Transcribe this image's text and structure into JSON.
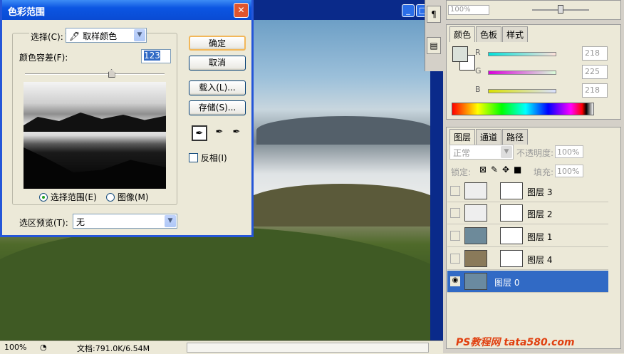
{
  "dialog": {
    "title": "色彩范围",
    "select_label": "选择(C):",
    "select_value": "取样颜色",
    "fuzziness_label": "颜色容差(F):",
    "fuzziness_value": "123",
    "ok_label": "确定",
    "cancel_label": "取消",
    "load_label": "载入(L)...",
    "save_label": "存储(S)...",
    "invert_label": "反相(I)",
    "radio_selection": "选择范围(E)",
    "radio_image": "图像(M)",
    "preview_label": "选区预览(T):",
    "preview_value": "无",
    "fuzziness_slider_fraction": 0.62
  },
  "document": {
    "zoom": "100%",
    "doc_info": "文档:791.0K/6.54M"
  },
  "navigator": {
    "zoom": "100%"
  },
  "color_panel": {
    "tabs": [
      "颜色",
      "色板",
      "样式"
    ],
    "r_label": "R",
    "g_label": "G",
    "b_label": "B",
    "r_value": "218",
    "g_value": "225",
    "b_value": "218",
    "colors": {
      "r_bar": "#40e0d0",
      "g_bar": "#e040e0",
      "b_bar": "#d0e040"
    }
  },
  "layers_panel": {
    "tabs": [
      "图层",
      "通道",
      "路径"
    ],
    "blend_mode": "正常",
    "opacity_label": "不透明度:",
    "opacity_value": "100%",
    "lock_label": "锁定:",
    "fill_label": "填充:",
    "fill_value": "100%",
    "layers": [
      {
        "name": "图层 3",
        "selected": false
      },
      {
        "name": "图层 2",
        "selected": false
      },
      {
        "name": "图层 1",
        "selected": false
      },
      {
        "name": "图层 4",
        "selected": false
      },
      {
        "name": "图层 0",
        "selected": true
      }
    ],
    "selection_color": "#316ac5"
  },
  "watermark": "PS教程网 tata580.com"
}
